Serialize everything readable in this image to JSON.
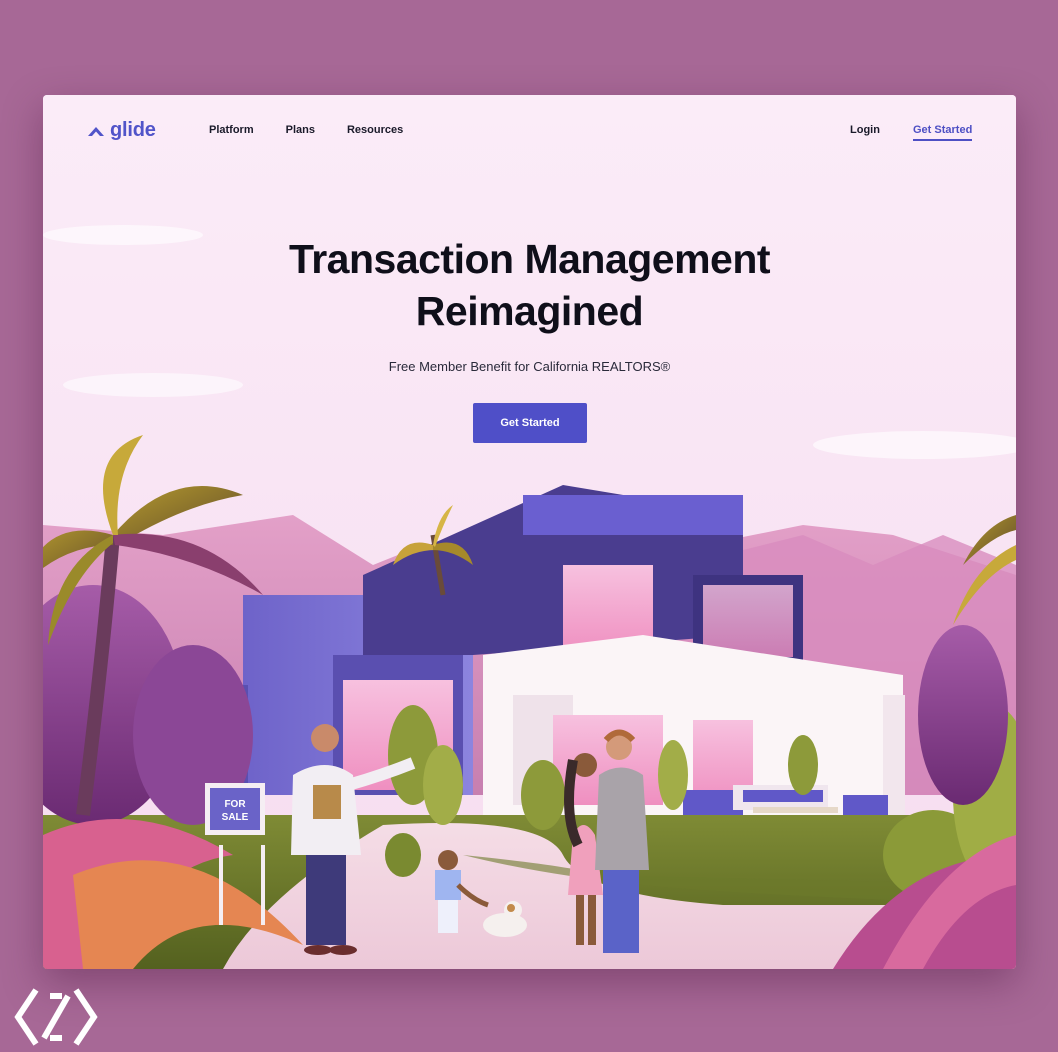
{
  "brand": {
    "name": "glide",
    "logo_icon": "chevron-up-icon",
    "color": "#5154c9"
  },
  "nav": {
    "links": [
      "Platform",
      "Plans",
      "Resources"
    ],
    "login": "Login",
    "get_started": "Get Started"
  },
  "hero": {
    "title_line1": "Transaction Management",
    "title_line2": "Reimagined",
    "subtitle": "Free Member Benefit for California REALTORS®",
    "cta": "Get Started"
  },
  "illustration": {
    "sign_line1": "FOR",
    "sign_line2": "SALE"
  },
  "colors": {
    "background": "#a76896",
    "page": "#fbecf8",
    "accent": "#4f4fc8"
  }
}
